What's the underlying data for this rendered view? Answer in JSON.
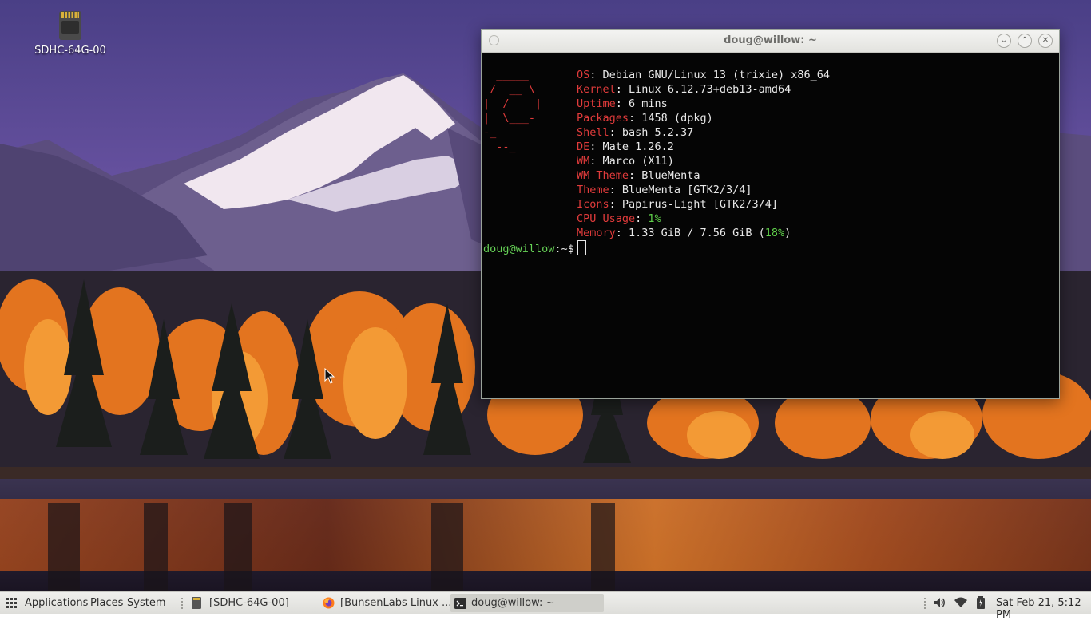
{
  "desktop": {
    "icons": [
      {
        "label": "SDHC-64G-00",
        "icon": "sd-card-icon"
      }
    ]
  },
  "terminal": {
    "title": "doug@willow: ~",
    "logo_lines": [
      "  _____",
      " /  __ \\",
      "|  /    |",
      "|  \\___-",
      "-_",
      "  --_"
    ],
    "info": [
      {
        "key": "OS",
        "value": "Debian GNU/Linux 13 (trixie) x86_64"
      },
      {
        "key": "Kernel",
        "value": "Linux 6.12.73+deb13-amd64"
      },
      {
        "key": "Uptime",
        "value": "6 mins"
      },
      {
        "key": "Packages",
        "value": "1458 (dpkg)"
      },
      {
        "key": "Shell",
        "value": "bash 5.2.37"
      },
      {
        "key": "DE",
        "value": "Mate 1.26.2"
      },
      {
        "key": "WM",
        "value": "Marco (X11)"
      },
      {
        "key": "WM Theme",
        "value": "BlueMenta"
      },
      {
        "key": "Theme",
        "value": "BlueMenta [GTK2/3/4]"
      },
      {
        "key": "Icons",
        "value": "Papirus-Light [GTK2/3/4]"
      },
      {
        "key": "CPU Usage",
        "value": "",
        "highlight": "1%"
      },
      {
        "key": "Memory",
        "value": "1.33 GiB / 7.56 GiB (",
        "highlight": "18%",
        "suffix": ")"
      }
    ],
    "prompt": "doug@willow",
    "prompt_suffix": ":~$",
    "controls": {
      "minimize": "⌄",
      "maximize": "⌃",
      "close": "✕"
    }
  },
  "panel": {
    "menu": {
      "applications": "Applications",
      "places": "Places",
      "system": "System"
    },
    "tasks": [
      {
        "label": "[SDHC-64G-00]",
        "icon": "sd-card-icon"
      },
      {
        "label": "[BunsenLabs Linux ...",
        "icon": "firefox-icon"
      },
      {
        "label": "doug@willow: ~",
        "icon": "terminal-icon",
        "active": true
      }
    ],
    "clock": "Sat Feb 21,  5:12 PM"
  },
  "colors": {
    "accent_red": "#e03b3b",
    "accent_green": "#5fcf4a",
    "panel_bg": "#e6e6e2"
  }
}
